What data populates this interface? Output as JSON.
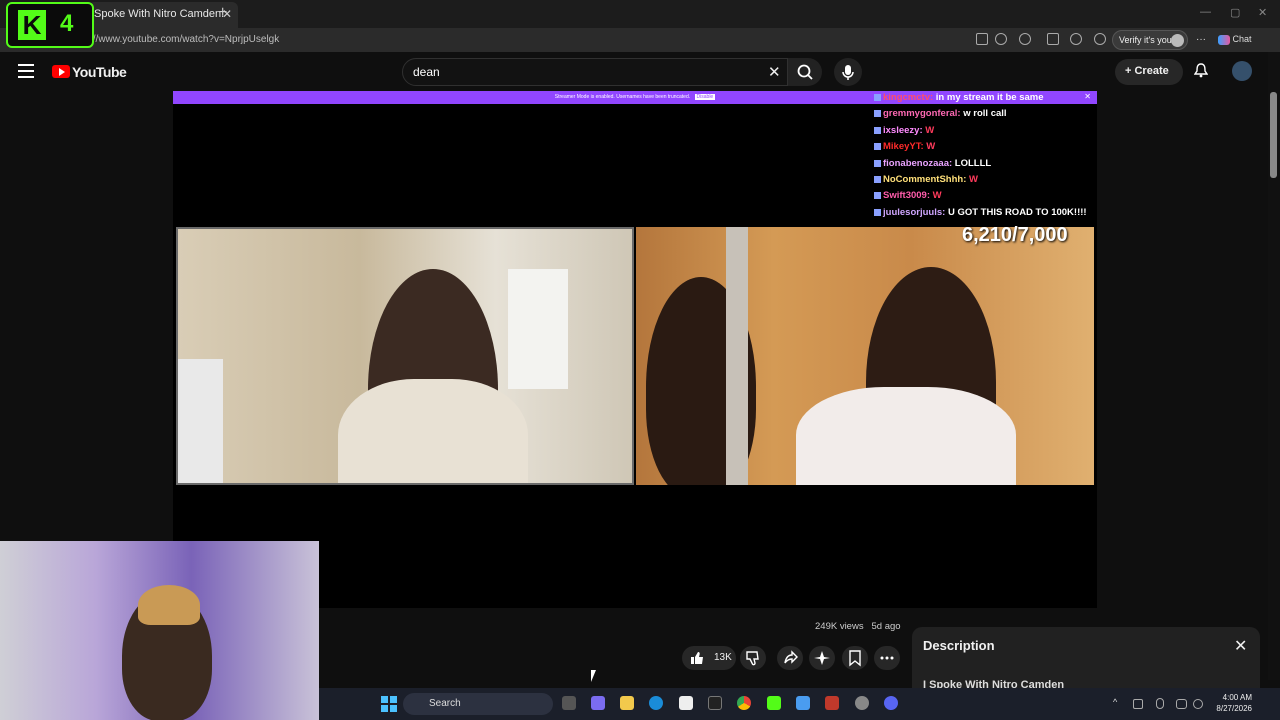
{
  "browser": {
    "tab_title": "Spoke With Nitro Camden.",
    "tab_close": "✕",
    "new_tab": "+",
    "url": "://www.youtube.com/watch?v=NprjpUselgk",
    "verify_label": "Verify it's you",
    "chat_label": "Chat",
    "more": "···"
  },
  "overlay": {
    "kick_letter": "K",
    "kick_number": "4"
  },
  "youtube": {
    "logo_text": "YouTube",
    "search_value": "dean",
    "clear": "✕",
    "create_label": "+ Create"
  },
  "stream": {
    "banner_text": "Streamer Mode is enabled. Usernames have been truncated.",
    "banner_button": "Disable",
    "banner_close": "✕",
    "counter": "6,210/7,000",
    "chat": [
      {
        "user": "kingcmctv:",
        "msg": "in my stream it be same",
        "color": "#ff4d6d"
      },
      {
        "user": "gremmygonferal:",
        "msg": "w roll call",
        "color": "#ff69b4"
      },
      {
        "user": "ixsleezy:",
        "msg": "W",
        "color": "#ff8cff"
      },
      {
        "user": "MikeyYT:",
        "msg": "W",
        "color": "#ff2a2a"
      },
      {
        "user": "fionabenozaaa:",
        "msg": "LOLLLL",
        "color": "#e9a3ff"
      },
      {
        "user": "NoCommentShhh:",
        "msg": "W",
        "color": "#ffe07a"
      },
      {
        "user": "Swift3009:",
        "msg": "W",
        "color": "#ff5cab"
      },
      {
        "user": "juulesorjuuls:",
        "msg": "U GOT THIS ROAD TO 100K!!!!",
        "color": "#cfa6ff"
      }
    ]
  },
  "video_info": {
    "views": "249K views",
    "age": "5d ago",
    "likes": "13K"
  },
  "description": {
    "title": "Description",
    "close": "✕",
    "subtitle": "I Spoke With Nitro Camden"
  },
  "taskbar": {
    "search_label": "Search",
    "time": "4:00 AM",
    "date": "8/27/2026"
  }
}
